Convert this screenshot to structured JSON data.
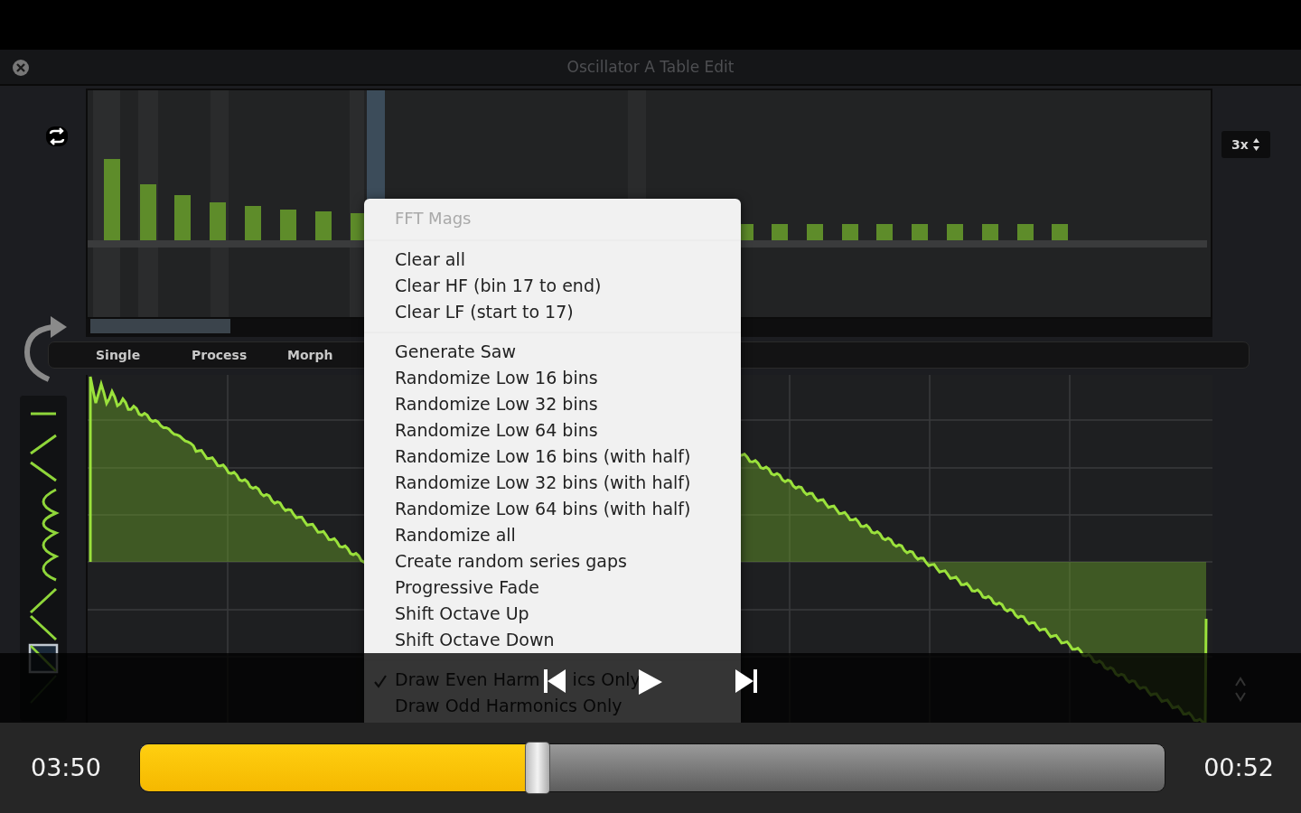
{
  "app_window": {
    "title": "Oscillator A Table Edit",
    "zoom_value": "3x",
    "tabs": [
      {
        "label": "Single",
        "selected": false
      },
      {
        "label": "Process",
        "selected": false
      },
      {
        "label": "Morph",
        "selected": false
      }
    ]
  },
  "context_menu": {
    "header": "FFT Mags",
    "groups": [
      [
        {
          "label": "Clear all",
          "checked": false
        },
        {
          "label": "Clear HF (bin 17 to end)",
          "checked": false
        },
        {
          "label": "Clear LF (start to 17)",
          "checked": false
        }
      ],
      [
        {
          "label": "Generate Saw",
          "checked": false
        },
        {
          "label": "Randomize Low 16 bins",
          "checked": false
        },
        {
          "label": "Randomize Low 32 bins",
          "checked": false
        },
        {
          "label": "Randomize Low 64 bins",
          "checked": false
        },
        {
          "label": "Randomize Low 16 bins (with half)",
          "checked": false
        },
        {
          "label": "Randomize Low 32 bins (with half)",
          "checked": false
        },
        {
          "label": "Randomize Low 64 bins (with half)",
          "checked": false
        },
        {
          "label": "Randomize all",
          "checked": false
        },
        {
          "label": "Create random series gaps",
          "checked": false
        },
        {
          "label": "Progressive Fade",
          "checked": false
        },
        {
          "label": "Shift Octave Up",
          "checked": false
        },
        {
          "label": "Shift Octave Down",
          "checked": false
        }
      ],
      [
        {
          "label": "Draw Even Harm",
          "label_tail": "ics Only",
          "checked": true
        },
        {
          "label": "Draw Odd Harmonics Only",
          "checked": false
        }
      ]
    ]
  },
  "player": {
    "elapsed": "03:50",
    "remaining": "00:52",
    "progress": {
      "level": 0.388
    }
  }
}
